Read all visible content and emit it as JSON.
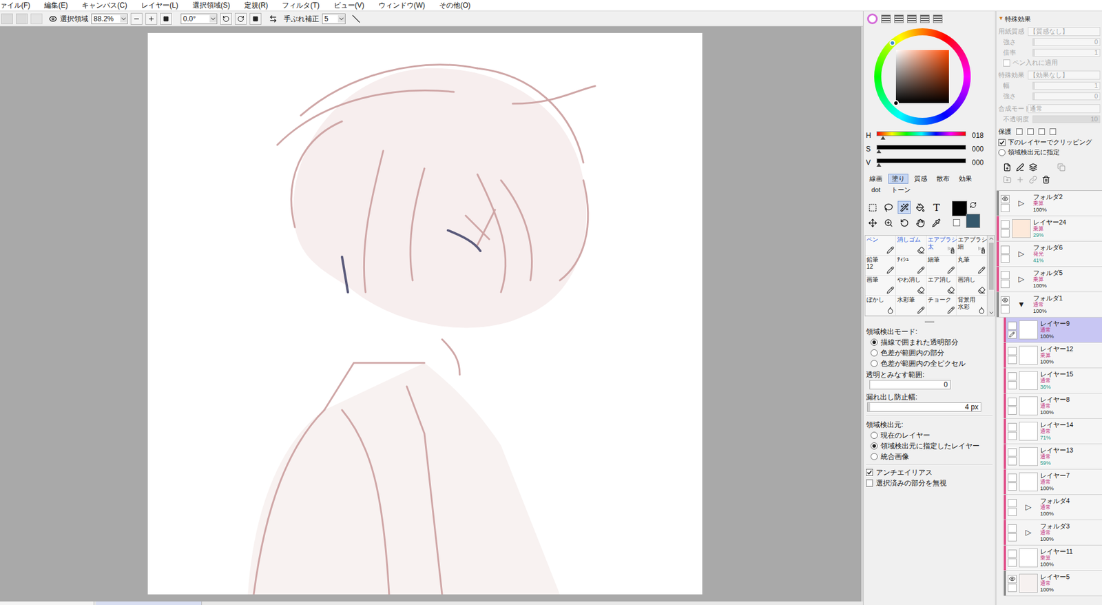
{
  "menu": [
    "ァイル(F)",
    "編集(E)",
    "キャンバス(C)",
    "レイヤー(L)",
    "選択領域(S)",
    "定規(R)",
    "フィルタ(T)",
    "ビュー(V)",
    "ウィンドウ(W)",
    "その他(O)"
  ],
  "toolbar": {
    "select_label": "選択領域",
    "zoom": "88.2%",
    "angle": "0.0°",
    "stabilizer_label": "手ぶれ補正",
    "stabilizer": "5"
  },
  "color": {
    "hsv": [
      {
        "label": "H",
        "value": "018",
        "level": 0.05,
        "kind": "hue"
      },
      {
        "label": "S",
        "value": "000",
        "level": 0,
        "kind": "plain"
      },
      {
        "label": "V",
        "value": "000",
        "level": 0,
        "kind": "plain"
      }
    ],
    "primary": "#000000",
    "secondary": "#35586c"
  },
  "tool_tabs": [
    {
      "label": "線画",
      "selected": false
    },
    {
      "label": "塗り",
      "selected": true
    },
    {
      "label": "質感",
      "selected": false
    },
    {
      "label": "散布",
      "selected": false
    },
    {
      "label": "効果",
      "selected": false
    },
    {
      "label": "dot",
      "selected": false
    },
    {
      "label": "トーン",
      "selected": false
    }
  ],
  "tools": [
    {
      "kind": "rect",
      "selected": false
    },
    {
      "kind": "lasso",
      "selected": false
    },
    {
      "kind": "wand",
      "selected": true
    },
    {
      "kind": "fill",
      "selected": false
    },
    {
      "kind": "text",
      "glyph": "T",
      "selected": false
    },
    {
      "kind": "move",
      "selected": false
    },
    {
      "kind": "zoom",
      "selected": false
    },
    {
      "kind": "rotate",
      "selected": false
    },
    {
      "kind": "hand",
      "selected": false
    },
    {
      "kind": "pipette",
      "selected": false
    }
  ],
  "brushes": [
    {
      "label": "ペン",
      "sub": "",
      "kind": "pen",
      "accent": true
    },
    {
      "label": "消しゴム",
      "sub": "",
      "kind": "eraser",
      "accent": true
    },
    {
      "label": "エアブラシ",
      "sub": "太",
      "kind": "airbrush",
      "accent": true
    },
    {
      "label": "エアブラシ",
      "sub": "細",
      "kind": "airbrush",
      "accent": false
    },
    {
      "label": "鉛筆",
      "sub": "12",
      "kind": "pen",
      "accent": false
    },
    {
      "label": "ﾃｨｼｭ",
      "sub": "",
      "kind": "pen",
      "accent": false
    },
    {
      "label": "細筆",
      "sub": "",
      "kind": "pen",
      "accent": false
    },
    {
      "label": "丸筆",
      "sub": "",
      "kind": "pen",
      "accent": false
    },
    {
      "label": "画筆",
      "sub": "",
      "kind": "pen",
      "accent": false
    },
    {
      "label": "やわ消し",
      "sub": "",
      "kind": "eraser",
      "accent": false
    },
    {
      "label": "エア消し",
      "sub": "",
      "kind": "eraser",
      "accent": false
    },
    {
      "label": "画消し",
      "sub": "",
      "kind": "eraser",
      "accent": false
    },
    {
      "label": "ぼかし",
      "sub": "",
      "kind": "blur",
      "accent": false
    },
    {
      "label": "水彩筆",
      "sub": "",
      "kind": "pen",
      "accent": false
    },
    {
      "label": "チョーク",
      "sub": "",
      "kind": "pen",
      "accent": false
    },
    {
      "label": "背景用",
      "sub": "水彩",
      "kind": "blur",
      "accent": false
    }
  ],
  "fill_options": {
    "mode_label": "領域検出モード:",
    "modes": [
      {
        "label": "描線で囲まれた透明部分",
        "selected": true
      },
      {
        "label": "色差が範囲内の部分",
        "selected": false
      },
      {
        "label": "色差が範囲内の全ピクセル",
        "selected": false
      }
    ],
    "range_label": "透明とみなす範囲:",
    "range_value": "0",
    "leak_label": "漏れ出し防止幅:",
    "leak_value": "4 px",
    "leak_level": 0.02,
    "source_label": "領域検出元:",
    "sources": [
      {
        "label": "現在のレイヤー",
        "selected": false
      },
      {
        "label": "領域検出元に指定したレイヤー",
        "selected": true
      },
      {
        "label": "統合画像",
        "selected": false
      }
    ],
    "checks": [
      {
        "label": "アンチエイリアス",
        "checked": true
      },
      {
        "label": "選択済みの部分を無視",
        "checked": false
      }
    ]
  },
  "effects": {
    "toggle": "▼",
    "title": "特殊効果",
    "rows": [
      {
        "kind": "select",
        "label": "用紙質感",
        "value": "【質感なし】"
      },
      {
        "kind": "slider",
        "label": "強さ",
        "value": "0",
        "level": 0
      },
      {
        "kind": "slider",
        "label": "倍率",
        "value": "1",
        "level": 0
      },
      {
        "kind": "check",
        "label": "ペン入れに適用",
        "checked": false
      },
      {
        "kind": "select",
        "label": "特殊効果",
        "value": "【効果なし】"
      },
      {
        "kind": "slider",
        "label": "幅",
        "value": "1",
        "level": 0.02
      },
      {
        "kind": "slider",
        "label": "強さ",
        "value": "0",
        "level": 0
      },
      {
        "kind": "select",
        "label": "合成モード",
        "value": "通常"
      },
      {
        "kind": "slider",
        "label": "不透明度",
        "value": "10",
        "level": 1
      }
    ],
    "protect_label": "保護",
    "clipping": {
      "label": "下のレイヤーでクリッピング",
      "checked": true
    },
    "source": {
      "label": "領域検出元に指定",
      "checked": false
    }
  },
  "layers": [
    {
      "name": "フォルダ2",
      "mode": "乗算",
      "opacity": "100%",
      "kind": "folder",
      "toggle": "▷",
      "visible": true,
      "clipped": false,
      "in_folder": false,
      "selected": false
    },
    {
      "name": "レイヤー24",
      "mode": "乗算",
      "opacity": "29%",
      "kind": "layer",
      "thumb": "#fde9da",
      "visible": false,
      "clipped": true,
      "in_folder": false,
      "selected": false
    },
    {
      "name": "フォルダ6",
      "mode": "発光",
      "opacity": "41%",
      "kind": "folder",
      "toggle": "▷",
      "visible": false,
      "clipped": true,
      "in_folder": false,
      "selected": false
    },
    {
      "name": "フォルダ5",
      "mode": "乗算",
      "opacity": "100%",
      "kind": "folder",
      "toggle": "▷",
      "visible": false,
      "clipped": true,
      "in_folder": false,
      "selected": false
    },
    {
      "name": "フォルダ1",
      "mode": "通常",
      "opacity": "100%",
      "kind": "folder",
      "toggle": "▼",
      "visible": true,
      "clipped": false,
      "in_folder": false,
      "selected": false
    },
    {
      "name": "レイヤー9",
      "mode": "通常",
      "opacity": "100%",
      "kind": "layer",
      "thumb": "#ffffff",
      "visible": false,
      "clipped": true,
      "in_folder": true,
      "selected": true
    },
    {
      "name": "レイヤー12",
      "mode": "乗算",
      "opacity": "100%",
      "kind": "layer",
      "thumb": "#ffffff",
      "visible": false,
      "clipped": true,
      "in_folder": true,
      "selected": false
    },
    {
      "name": "レイヤー15",
      "mode": "通常",
      "opacity": "36%",
      "kind": "layer",
      "thumb": "#ffffff",
      "visible": false,
      "clipped": true,
      "in_folder": true,
      "selected": false
    },
    {
      "name": "レイヤー8",
      "mode": "通常",
      "opacity": "100%",
      "kind": "layer",
      "thumb": "#ffffff",
      "visible": false,
      "clipped": true,
      "in_folder": true,
      "selected": false
    },
    {
      "name": "レイヤー14",
      "mode": "通常",
      "opacity": "71%",
      "kind": "layer",
      "thumb": "#ffffff",
      "visible": false,
      "clipped": true,
      "in_folder": true,
      "selected": false
    },
    {
      "name": "レイヤー13",
      "mode": "通常",
      "opacity": "59%",
      "kind": "layer",
      "thumb": "#ffffff",
      "visible": false,
      "clipped": true,
      "in_folder": true,
      "selected": false
    },
    {
      "name": "レイヤー7",
      "mode": "通常",
      "opacity": "100%",
      "kind": "layer",
      "thumb": "#ffffff",
      "visible": false,
      "clipped": true,
      "in_folder": true,
      "selected": false
    },
    {
      "name": "フォルダ4",
      "mode": "通常",
      "opacity": "100%",
      "kind": "folder",
      "toggle": "▷",
      "visible": false,
      "clipped": true,
      "in_folder": true,
      "selected": false
    },
    {
      "name": "フォルダ3",
      "mode": "通常",
      "opacity": "100%",
      "kind": "folder",
      "toggle": "▷",
      "visible": false,
      "clipped": true,
      "in_folder": true,
      "selected": false
    },
    {
      "name": "レイヤー11",
      "mode": "乗算",
      "opacity": "100%",
      "kind": "layer",
      "thumb": "#ffffff",
      "visible": false,
      "clipped": true,
      "in_folder": true,
      "selected": false
    },
    {
      "name": "レイヤー5",
      "mode": "通常",
      "opacity": "100%",
      "kind": "layer",
      "thumb": "#f6f1f0",
      "visible": true,
      "clipped": false,
      "in_folder": true,
      "selected": false
    }
  ]
}
